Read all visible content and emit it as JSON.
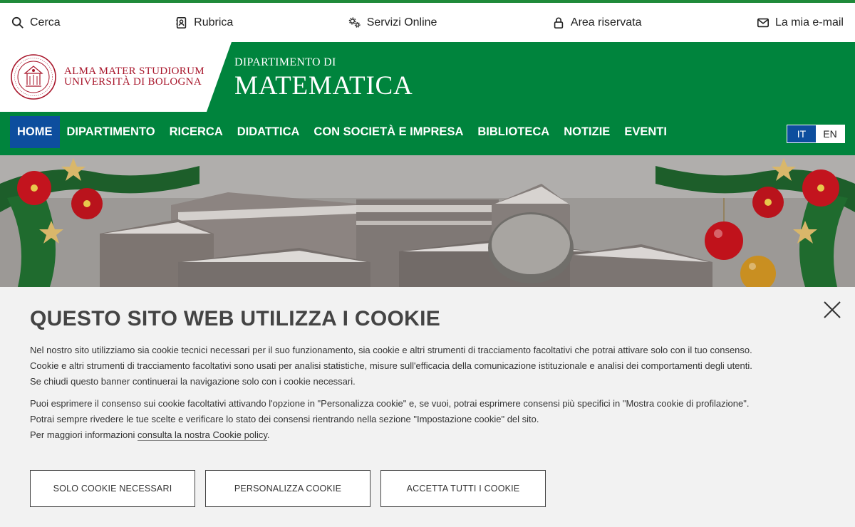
{
  "utility": {
    "search": "Cerca",
    "rubrica": "Rubrica",
    "servizi": "Servizi Online",
    "area": "Area riservata",
    "email": "La mia e-mail"
  },
  "brand": {
    "uni_line1": "ALMA MATER STUDIORUM",
    "uni_line2": "UNIVERSITÀ DI BOLOGNA",
    "dept_small": "DIPARTIMENTO DI",
    "dept_big": "MATEMATICA"
  },
  "nav": {
    "items": [
      "HOME",
      "DIPARTIMENTO",
      "RICERCA",
      "DIDATTICA",
      "CON SOCIETÀ E IMPRESA",
      "BIBLIOTECA",
      "NOTIZIE",
      "EVENTI"
    ],
    "active": "HOME"
  },
  "lang": {
    "it": "IT",
    "en": "EN"
  },
  "cookie": {
    "title": "QUESTO SITO WEB UTILIZZA I COOKIE",
    "p1_l1": "Nel nostro sito utilizziamo sia cookie tecnici necessari per il suo funzionamento, sia cookie e altri strumenti di tracciamento facoltativi che potrai attivare solo con il tuo consenso.",
    "p1_l2": "Cookie e altri strumenti di tracciamento facoltativi sono usati per analisi statistiche, misure sull'efficacia della comunicazione istituzionale e analisi dei comportamenti degli utenti.",
    "p1_l3": "Se chiudi questo banner continuerai la navigazione solo con i cookie necessari.",
    "p2_l1": "Puoi esprimere il consenso sui cookie facoltativi attivando l'opzione in \"Personalizza cookie\" e, se vuoi, potrai esprimere consensi più specifici in \"Mostra cookie di profilazione\".",
    "p2_l2": "Potrai sempre rivedere le tue scelte e verificare lo stato dei consensi rientrando nella sezione \"Impostazione cookie\" del sito.",
    "p2_l3_prefix": "Per maggiori informazioni ",
    "p2_l3_link": "consulta la nostra Cookie policy",
    "p2_l3_suffix": ".",
    "btn_necessary": "SOLO COOKIE NECESSARI",
    "btn_customize": "PERSONALIZZA COOKIE",
    "btn_accept": "ACCETTA TUTTI I COOKIE"
  },
  "colors": {
    "green": "#00843d",
    "blue": "#0d4e9e",
    "uni_red": "#a8162b"
  }
}
